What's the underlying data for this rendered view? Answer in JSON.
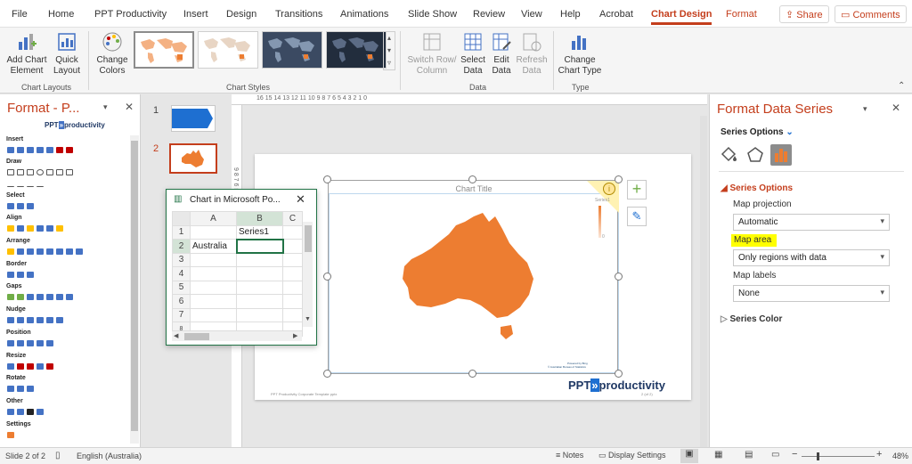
{
  "menu": {
    "tabs": [
      "File",
      "Home",
      "PPT Productivity",
      "Insert",
      "Design",
      "Transitions",
      "Animations",
      "Slide Show",
      "Review",
      "View",
      "Help",
      "Acrobat",
      "Chart Design",
      "Format"
    ],
    "share": "Share",
    "comments": "Comments"
  },
  "ribbon": {
    "add_chart_element": "Add Chart Element",
    "quick_layout": "Quick Layout",
    "change_colors": "Change Colors",
    "switch_row_column": "Switch Row/ Column",
    "select_data": "Select Data",
    "edit_data": "Edit Data",
    "refresh_data": "Refresh Data",
    "change_chart_type": "Change Chart Type",
    "group_chart_layouts": "Chart Layouts",
    "group_chart_styles": "Chart Styles",
    "group_data": "Data",
    "group_type": "Type"
  },
  "left_pane": {
    "title": "Format - P...",
    "logo_ppt": "PPT",
    "logo_product": "productivity",
    "sections": [
      "Insert",
      "Draw",
      "Select",
      "Align",
      "Arrange",
      "Border",
      "Gaps",
      "Nudge",
      "Position",
      "Resize",
      "Rotate",
      "Other",
      "Settings"
    ]
  },
  "slides": {
    "numbers": [
      "1",
      "2"
    ]
  },
  "ruler": {
    "top": "16 15 14 13 12 11 10 9 8 7 6 5 4 3 2 1 0",
    "left": "9 8 7 6 5 4"
  },
  "slide": {
    "chart_title": "Chart Title",
    "legend_label": "Series1",
    "legend_min": "0",
    "attribution_1": "Powered by Bing",
    "attribution_2": "© Australian Bureau of Statistics",
    "logo_ppt": "PPT",
    "logo_product": "productivity",
    "footer": "PPT Productivity Corporate Template pptx",
    "page": "2 (of 2)"
  },
  "data_window": {
    "title": "Chart in Microsoft Po...",
    "columns": [
      "A",
      "B",
      "C"
    ],
    "rows": [
      {
        "num": "1",
        "a": "",
        "b": "Series1"
      },
      {
        "num": "2",
        "a": "Australia",
        "b": ""
      },
      {
        "num": "3",
        "a": "",
        "b": ""
      },
      {
        "num": "4",
        "a": "",
        "b": ""
      },
      {
        "num": "5",
        "a": "",
        "b": ""
      },
      {
        "num": "6",
        "a": "",
        "b": ""
      },
      {
        "num": "7",
        "a": "",
        "b": ""
      },
      {
        "num": "8",
        "a": "",
        "b": ""
      }
    ]
  },
  "right_pane": {
    "title": "Format Data Series",
    "series_options_dropdown": "Series Options",
    "series_options_section": "Series Options",
    "map_projection_label": "Map projection",
    "map_projection_value": "Automatic",
    "map_area_label": "Map area",
    "map_area_value": "Only regions with data",
    "map_labels_label": "Map labels",
    "map_labels_value": "None",
    "series_color": "Series Color"
  },
  "status": {
    "slide": "Slide 2 of 2",
    "language": "English (Australia)",
    "notes": "Notes",
    "display_settings": "Display Settings",
    "zoom": "48%"
  },
  "colors": {
    "accent": "#c43e1c",
    "map_fill": "#ed7d31",
    "highlight": "#ffff00",
    "excel_green": "#217346"
  }
}
